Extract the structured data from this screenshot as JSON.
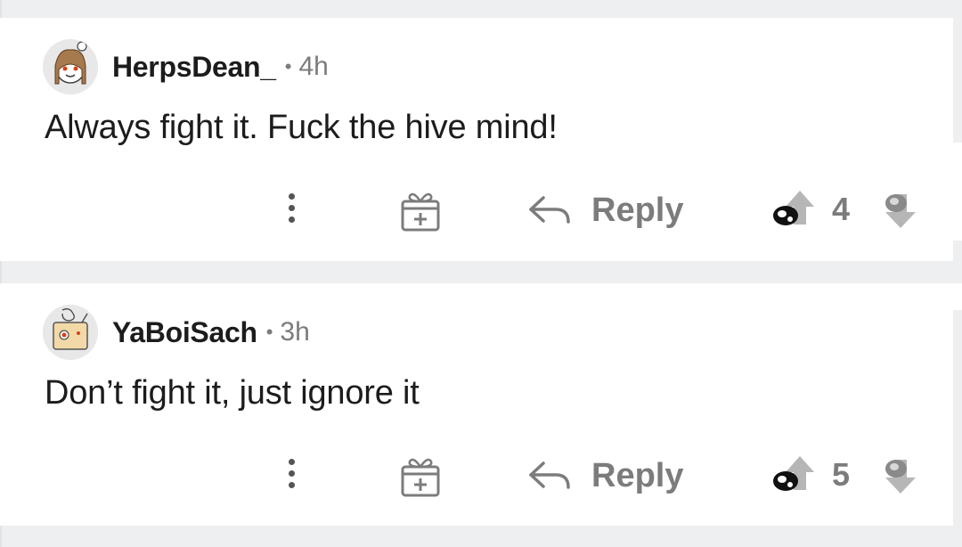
{
  "comments": [
    {
      "username": "HerpsDean_",
      "separator": "•",
      "age": "4h",
      "text": "Always fight it. Fuck the hive mind!",
      "reply_label": "Reply",
      "score": "4"
    },
    {
      "username": "YaBoiSach",
      "separator": "•",
      "age": "3h",
      "text": "Don’t fight it, just ignore it",
      "reply_label": "Reply",
      "score": "5"
    }
  ],
  "colors": {
    "background": "#eeeff1",
    "card": "#ffffff",
    "muted_text": "#7c7c7c",
    "primary_text": "#1c1c1c"
  },
  "icons": [
    "more-options-icon",
    "award-icon",
    "reply-arrow-icon",
    "upvote-icon",
    "downvote-icon"
  ]
}
